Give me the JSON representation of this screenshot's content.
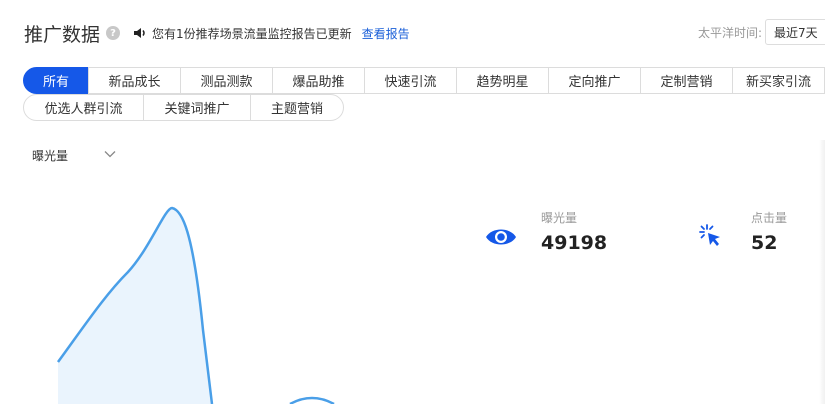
{
  "header": {
    "title": "推广数据",
    "help": "?",
    "notice": "您有1份推荐场景流量监控报告已更新",
    "report_link": "查看报告",
    "timezone_label": "太平洋时间:",
    "range": "最近7天"
  },
  "tabs": [
    {
      "label": "所有",
      "active": true
    },
    {
      "label": "新品成长"
    },
    {
      "label": "测品测款"
    },
    {
      "label": "爆品助推"
    },
    {
      "label": "快速引流"
    },
    {
      "label": "趋势明星"
    },
    {
      "label": "定向推广"
    },
    {
      "label": "定制营销"
    },
    {
      "label": "新买家引流"
    },
    {
      "label": "优选人群引流"
    },
    {
      "label": "关键词推广"
    },
    {
      "label": "主题营销"
    }
  ],
  "metric_select": {
    "selected": "曝光量"
  },
  "stats": {
    "impressions": {
      "label": "曝光量",
      "value": "49198"
    },
    "clicks": {
      "label": "点击量",
      "value": "52"
    }
  },
  "colors": {
    "accent": "#1558e8",
    "line": "#4a9fe8",
    "area": "#eaf4fd"
  }
}
